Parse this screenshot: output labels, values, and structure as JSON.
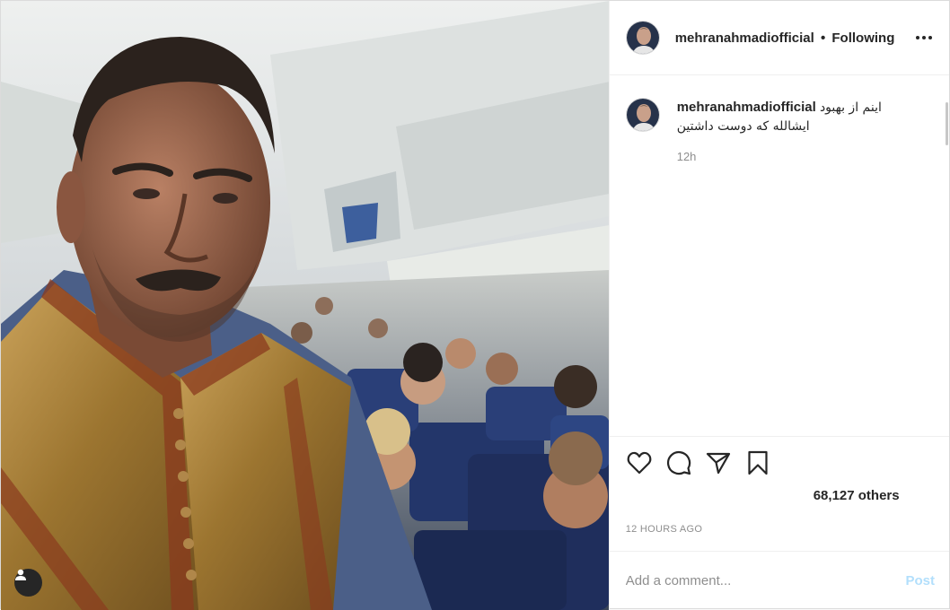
{
  "photo": {
    "alt_icon": "user-tag-icon"
  },
  "header": {
    "username": "mehranahmadiofficial",
    "separator": "•",
    "follow_state": "Following",
    "more_icon": "more-dots-icon"
  },
  "caption": {
    "username": "mehranahmadiofficial",
    "line1": "اینم از بهبود",
    "line2": "ایشالله که دوست داشتین",
    "time": "12h"
  },
  "actions": {
    "like_icon": "heart-icon",
    "comment_icon": "comment-icon",
    "share_icon": "share-icon",
    "save_icon": "bookmark-icon"
  },
  "likes": {
    "text": "68,127 others"
  },
  "timestamp": "12 HOURS AGO",
  "comment_box": {
    "placeholder": "Add a comment...",
    "post_label": "Post"
  },
  "colors": {
    "text": "#262626",
    "muted": "#8e8e8e",
    "border": "#efefef",
    "post_disabled": "#b2dffc"
  }
}
